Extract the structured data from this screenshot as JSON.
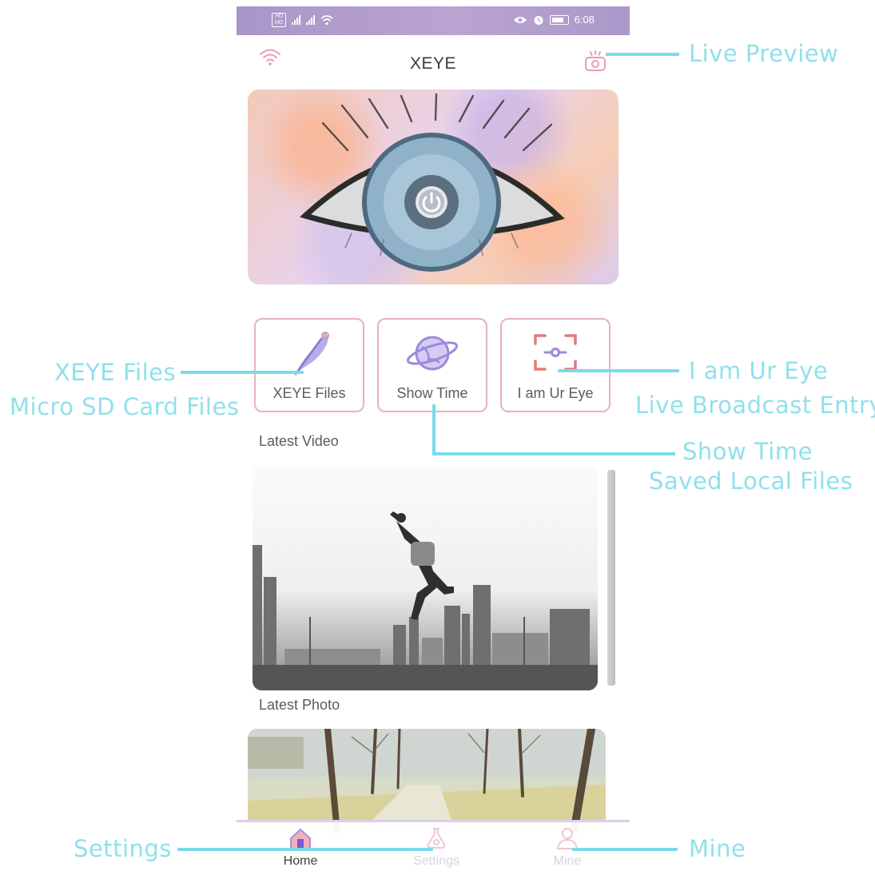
{
  "status_bar": {
    "sim1": "SIM1",
    "sim2": "SIM2",
    "time": "6:08"
  },
  "header": {
    "title": "XEYE",
    "left_icon": "wifi-icon",
    "right_icon": "live-camera-icon"
  },
  "hero": {
    "icon": "power-icon"
  },
  "tiles": [
    {
      "label": "XEYE Files",
      "icon": "feather-icon"
    },
    {
      "label": "Show Time",
      "icon": "planet-icon"
    },
    {
      "label": "I am Ur Eye",
      "icon": "focus-frame-icon"
    }
  ],
  "sections": {
    "latest_video": "Latest Video",
    "latest_photo": "Latest Photo"
  },
  "tabbar": {
    "items": [
      {
        "label": "Home",
        "icon": "home-icon",
        "active": true
      },
      {
        "label": "Settings",
        "icon": "settings-icon",
        "active": false
      },
      {
        "label": "Mine",
        "icon": "person-icon",
        "active": false
      }
    ]
  },
  "annotations": {
    "live_preview": "Live Preview",
    "xeye_files": "XEYE Files",
    "micro_sd": "Micro SD Card Files",
    "i_am_ur_eye": "I am Ur Eye",
    "live_broadcast": "Live Broadcast Entry",
    "show_time": "Show Time",
    "saved_local": "Saved Local Files",
    "settings": "Settings",
    "mine": "Mine"
  },
  "colors": {
    "annotation": "#8fe0ec",
    "tile_border": "#e7b2bd",
    "status_bar": "#b6a2d0",
    "icon_purple": "#9b8fd8",
    "icon_red": "#e47a7a"
  }
}
